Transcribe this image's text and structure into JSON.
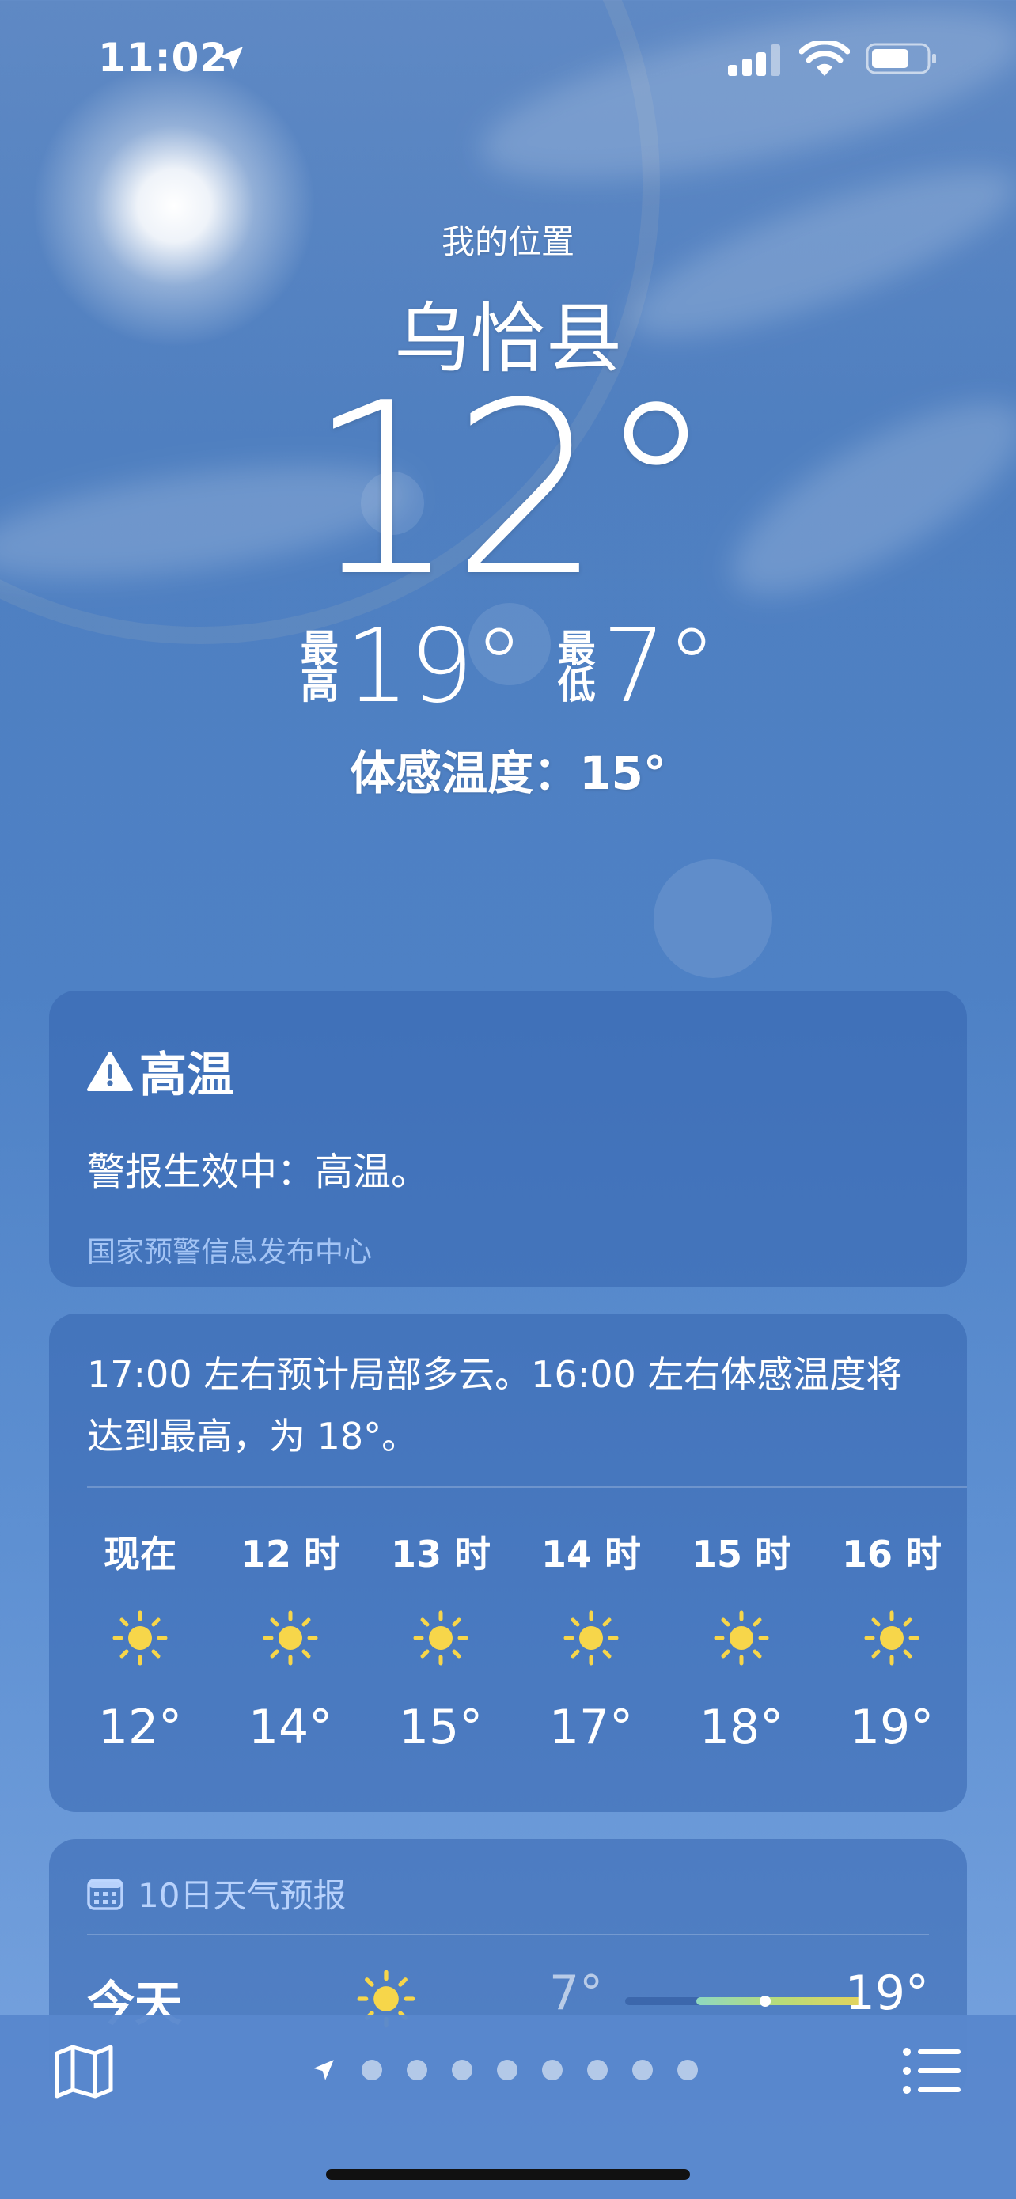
{
  "status_bar": {
    "time": "11:02"
  },
  "header": {
    "location_label": "我的位置",
    "city": "乌恰县",
    "current_temp": "12°",
    "high_label": "最高",
    "high": "19°",
    "low_label": "最低",
    "low": "7°",
    "feels_like": "体感温度：15°"
  },
  "alert": {
    "title": "高温",
    "body": "警报生效中：高温。",
    "source": "国家预警信息发布中心"
  },
  "hourly": {
    "summary": "17:00 左右预计局部多云。16:00 左右体感温度将达到最高，为 18°。",
    "hours": [
      {
        "label": "现在",
        "icon": "sun-icon",
        "temp": "12°"
      },
      {
        "label": "12 时",
        "icon": "sun-icon",
        "temp": "14°"
      },
      {
        "label": "13 时",
        "icon": "sun-icon",
        "temp": "15°"
      },
      {
        "label": "14 时",
        "icon": "sun-icon",
        "temp": "17°"
      },
      {
        "label": "15 时",
        "icon": "sun-icon",
        "temp": "18°"
      },
      {
        "label": "16 时",
        "icon": "sun-icon",
        "temp": "19°"
      }
    ]
  },
  "forecast": {
    "title": "10日天气预报",
    "rows": [
      {
        "day": "今天",
        "icon": "sun-icon",
        "low": "7°",
        "high": "19°"
      }
    ]
  },
  "bottom_bar": {
    "page_count": 8,
    "active_page": 0
  },
  "colors": {
    "sun_icon": "#f7d64a",
    "card_bg": "#3464af",
    "source_text": "#b4d2ff"
  }
}
